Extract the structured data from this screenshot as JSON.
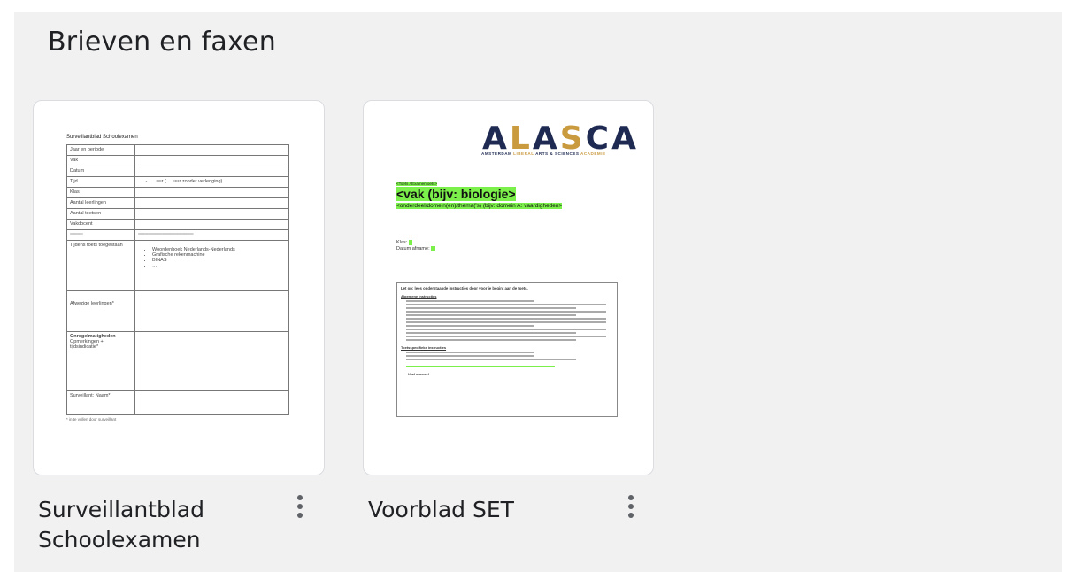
{
  "section": {
    "title": "Brieven en faxen"
  },
  "documents": [
    {
      "name": "Surveillantblad Schoolexamen",
      "thumbnail": {
        "title": "Surveillantblad Schoolexamen",
        "rows": [
          [
            "Jaar en periode",
            ""
          ],
          [
            "Vak",
            ""
          ],
          [
            "Datum",
            ""
          ],
          [
            "Tijd",
            "…. - …. uur (…. uur zonder verlenging)"
          ],
          [
            "Klas",
            ""
          ],
          [
            "Aantal leerlingen",
            ""
          ],
          [
            "Aantal toetsen",
            ""
          ],
          [
            "Vakdocent",
            ""
          ],
          [
            "==========",
            "==========================================="
          ]
        ],
        "allowed_label": "Tijdens toets toegestaan",
        "allowed_items": [
          "Woordenboek Nederlands-Nederlands",
          "Grafische rekenmachine",
          "BINAS",
          "…"
        ],
        "absent_label": "Afwezige leerlingen*",
        "irregular_label_bold": "Onregelmatigheden",
        "irregular_label": "Opmerkingen + tijdsindicatie*",
        "supervisor_label": "Surveillant: Naam*",
        "footnote": "* in te vullen door surveillant"
      }
    },
    {
      "name": "Voorblad SET",
      "thumbnail": {
        "logo": "ALASCA",
        "logo_sub_a": "AMSTERDAM ",
        "logo_sub_b": "LIBERAL ",
        "logo_sub_c": "ARTS & SCIENCES ",
        "logo_sub_d": "ACADEMIE",
        "type_label": "<Toets / Examentoets>",
        "vak": "<vak (bijv: biologie>",
        "subtitle": "<onderdeel/domein(en)/thema('s) (bijv: domein A: vaardigheden>",
        "klas_label": "Klas:",
        "datum_label": "Datum afname:",
        "instructions_title": "Let op: lees onderstaande instructies door voor je begint aan de toets.",
        "general_title": "Algemene instructies",
        "specific_title": "Toetsspecifieke instructies",
        "closing": "Veel succes!"
      }
    }
  ],
  "colors": {
    "panel": "#f1f1f1",
    "highlight": "#7cf04a",
    "logo_navy": "#1e2a52",
    "logo_gold": "#c99a3e"
  },
  "icons": {
    "more": "more-vert-icon"
  }
}
